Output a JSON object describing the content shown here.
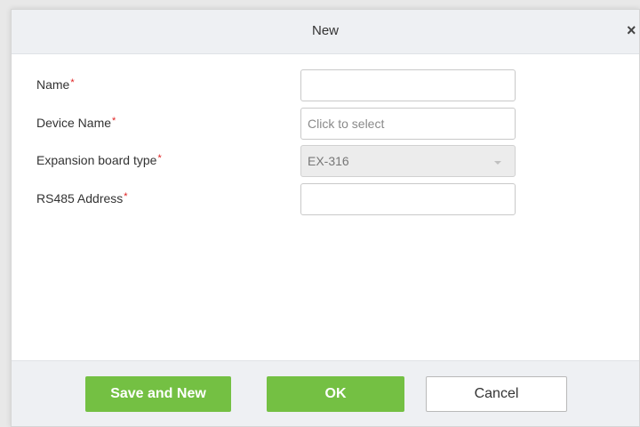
{
  "dialog": {
    "title": "New",
    "close_glyph": "×"
  },
  "form": {
    "required_mark": "*",
    "fields": [
      {
        "label": "Name",
        "value": "",
        "placeholder": ""
      },
      {
        "label": "Device Name",
        "value": "",
        "placeholder": "Click to select"
      },
      {
        "label": "Expansion board type",
        "value": "EX-316"
      },
      {
        "label": "RS485 Address",
        "value": "",
        "placeholder": ""
      }
    ]
  },
  "footer": {
    "save_and_new_label": "Save and New",
    "ok_label": "OK",
    "cancel_label": "Cancel"
  },
  "colors": {
    "primary_button": "#74c043",
    "required_mark": "#e02020",
    "title_bar": "#eef0f3"
  },
  "icons": {
    "close": "close-icon",
    "dropdown": "chevron-down-icon"
  }
}
